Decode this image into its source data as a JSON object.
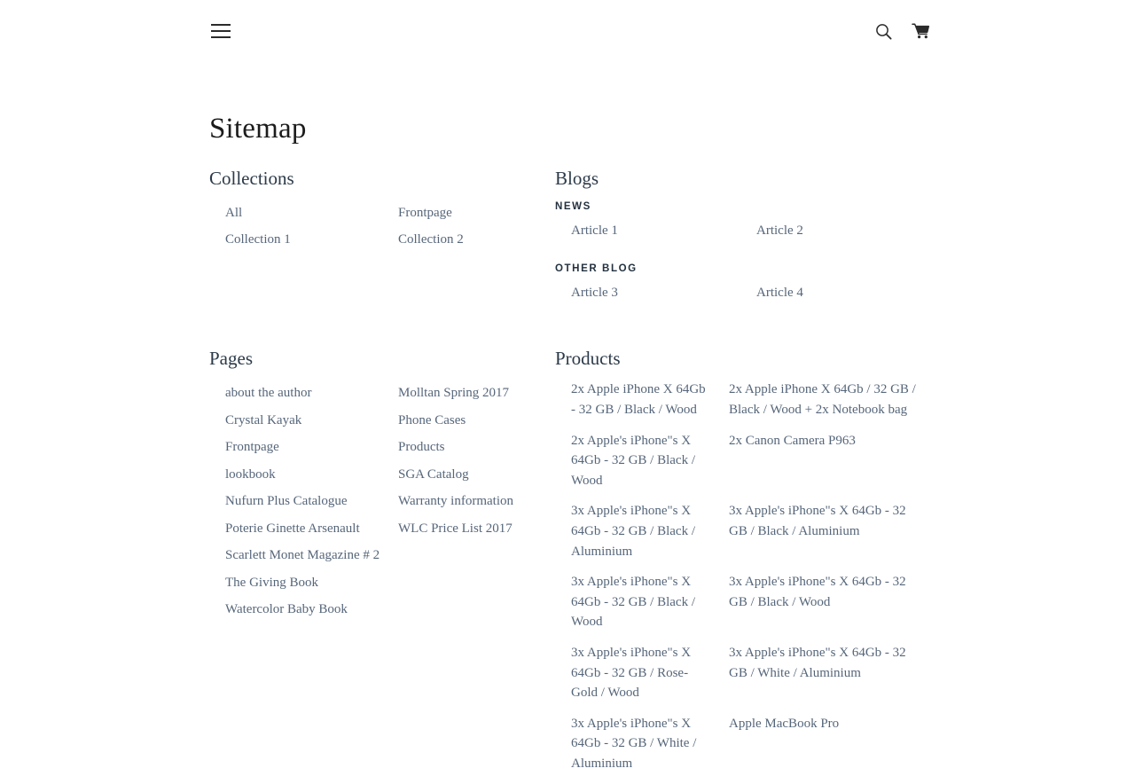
{
  "header": {
    "menu_label": "Menu",
    "search_label": "Search",
    "cart_label": "Cart",
    "menu_icon": "hamburger-icon",
    "search_icon": "search-icon",
    "cart_icon": "shopping-cart-icon"
  },
  "page": {
    "title": "Sitemap"
  },
  "collections": {
    "heading": "Collections",
    "col1": [
      "All",
      "Collection 1"
    ],
    "col2": [
      "Frontpage",
      "Collection 2"
    ]
  },
  "blogs": {
    "heading": "Blogs",
    "groups": [
      {
        "name": "NEWS",
        "col1": [
          "Article 1"
        ],
        "col2": [
          "Article 2"
        ]
      },
      {
        "name": "OTHER BLOG",
        "col1": [
          "Article 3"
        ],
        "col2": [
          "Article 4"
        ]
      }
    ]
  },
  "pages": {
    "heading": "Pages",
    "col1": [
      "about the author",
      "Crystal Kayak",
      "Frontpage",
      "lookbook",
      "Nufurn Plus Catalogue",
      "Poterie Ginette Arsenault",
      "Scarlett Monet Magazine # 2",
      "The Giving Book",
      "Watercolor Baby Book"
    ],
    "col2": [
      "Molltan Spring 2017",
      "Phone Cases",
      "Products",
      "SGA Catalog",
      "Warranty information",
      "WLC Price List 2017"
    ]
  },
  "products": {
    "heading": "Products",
    "rows": [
      {
        "left": "2x Apple iPhone X 64Gb - 32 GB / Black / Wood",
        "right": "2x Apple iPhone X 64Gb / 32 GB / Black / Wood + 2x Notebook bag"
      },
      {
        "left": "2x Apple's iPhone\"s X 64Gb - 32 GB / Black / Wood",
        "right": "2x Canon Camera P963"
      },
      {
        "left": "3x Apple's iPhone\"s X 64Gb - 32 GB / Black / Aluminium",
        "right": "3x Apple's iPhone\"s X 64Gb - 32 GB / Black / Aluminium"
      },
      {
        "left": "3x Apple's iPhone\"s X 64Gb - 32 GB / Black / Wood",
        "right": "3x Apple's iPhone\"s X 64Gb - 32 GB / Black / Wood"
      },
      {
        "left": "3x Apple's iPhone\"s X 64Gb - 32 GB / Rose-Gold / Wood",
        "right": "3x Apple's iPhone\"s X 64Gb - 32 GB / White / Aluminium"
      },
      {
        "left": "3x Apple's iPhone\"s X 64Gb - 32 GB / White / Aluminium",
        "right": "Apple MacBook Pro"
      }
    ]
  },
  "colors": {
    "text": "#3a4a5c",
    "link": "#56667a",
    "heading": "#2c3a49",
    "title": "#1c1c1c",
    "background": "#ffffff"
  }
}
